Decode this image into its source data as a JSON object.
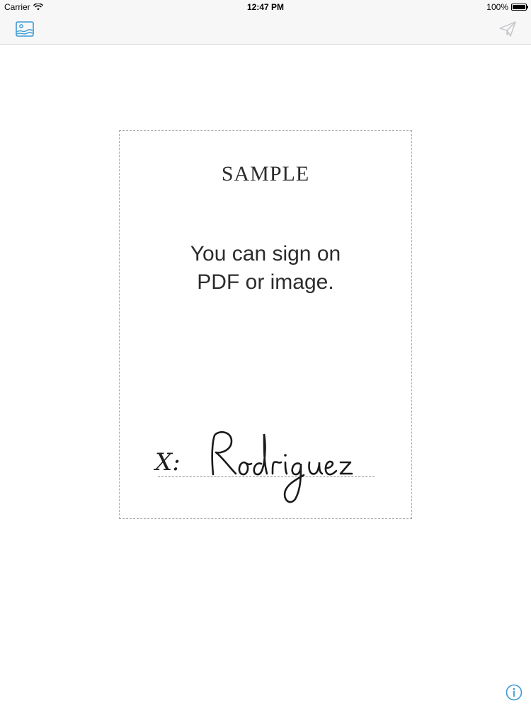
{
  "status_bar": {
    "carrier": "Carrier",
    "time": "12:47 PM",
    "battery": "100%",
    "battery_level": 1.0
  },
  "toolbar": {
    "left_icon": "photo-icon",
    "right_icon": "paper-plane-icon",
    "accent_color": "#3b99d6",
    "disabled_color": "#c4c4c8"
  },
  "document": {
    "title": "SAMPLE",
    "line1": "You can sign on",
    "line2": "PDF or image.",
    "signature_label": "X:",
    "signature_name": "Rodriguez"
  },
  "footer": {
    "info_icon": "info-icon"
  }
}
